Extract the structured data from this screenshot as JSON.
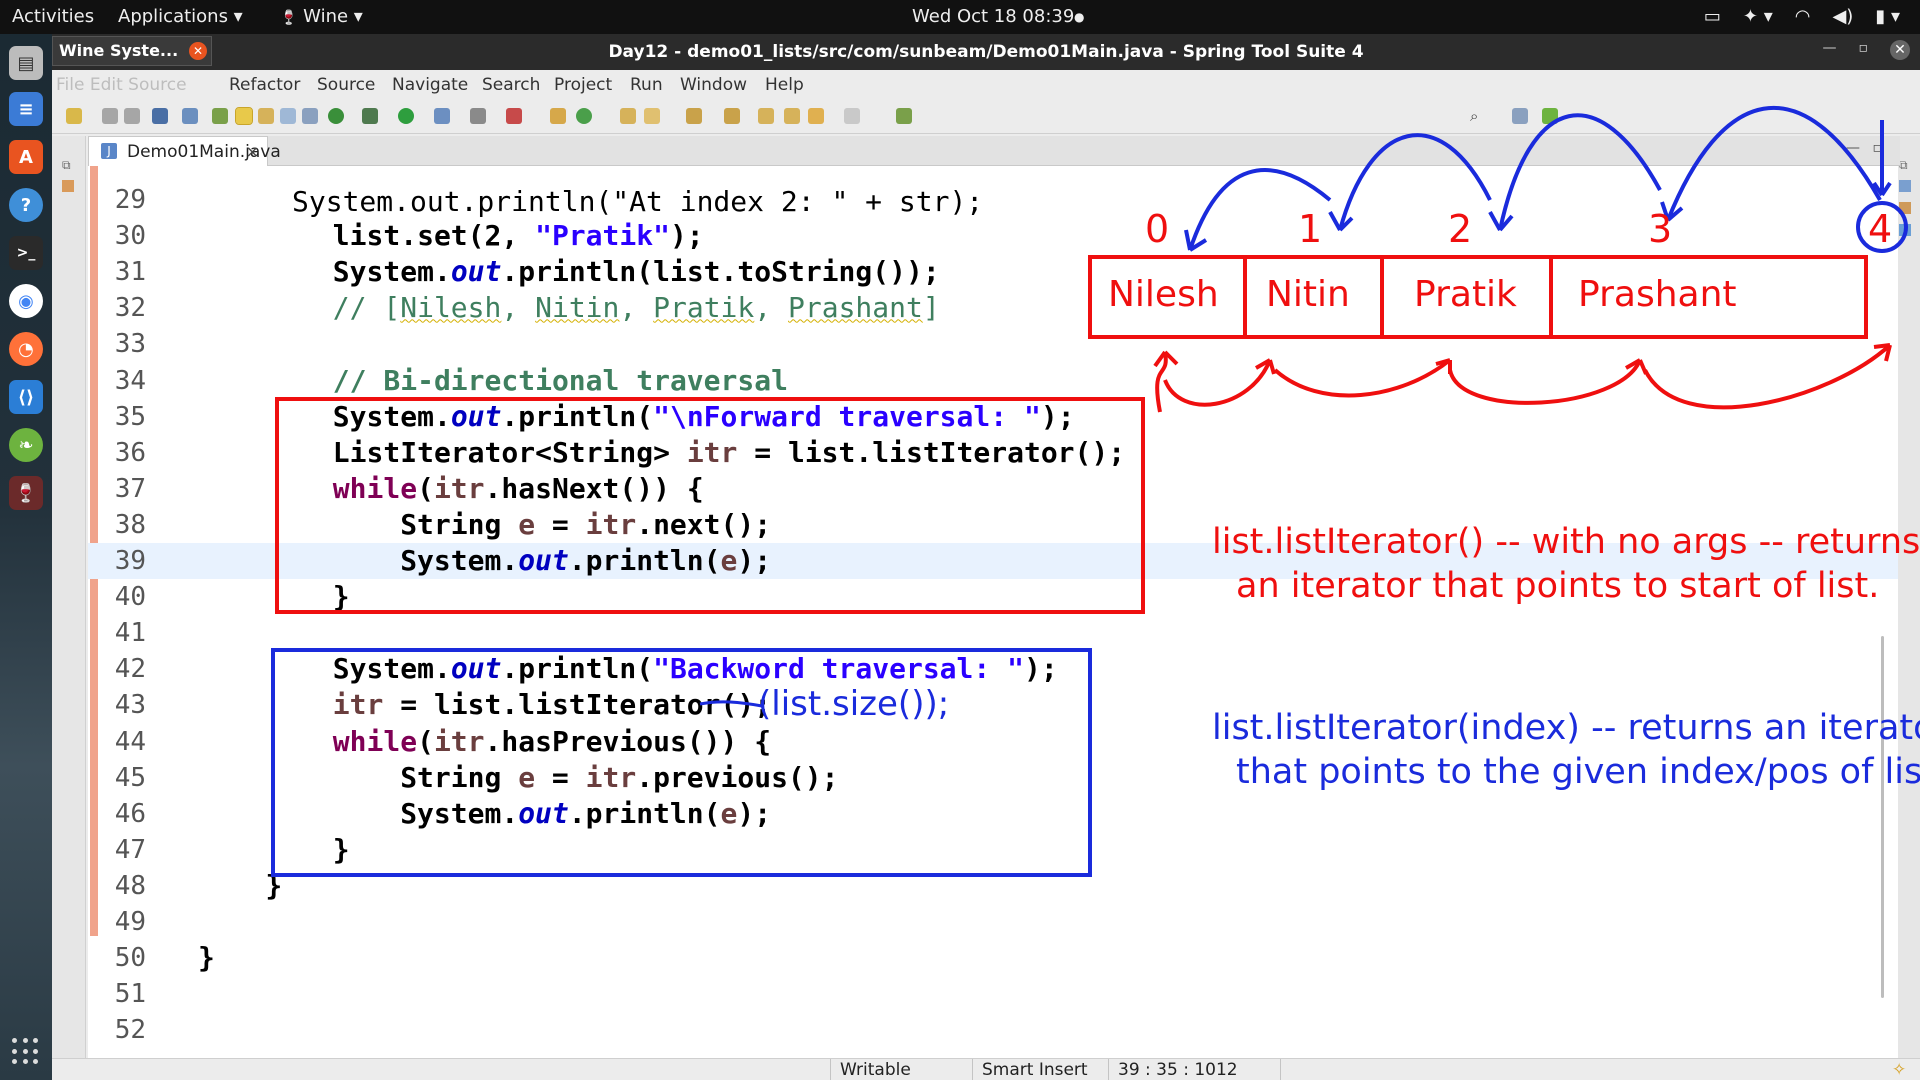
{
  "topbar": {
    "activities": "Activities",
    "applications": "Applications ▾",
    "wine": "Wine ▾",
    "clock": "Wed Oct 18  08:39",
    "tray_icons": [
      "display-icon",
      "accessibility-icon",
      "network-icon",
      "volume-icon",
      "battery-icon"
    ]
  },
  "dock": {
    "apps": [
      "files-icon",
      "text-editor-icon",
      "software-store-icon",
      "help-icon",
      "terminal-icon",
      "chrome-icon",
      "firefox-icon",
      "vscode-icon",
      "spring-icon",
      "wine-icon"
    ]
  },
  "window": {
    "title": "Day12 - demo01_lists/src/com/sunbeam/Demo01Main.java - Spring Tool Suite 4",
    "wine_popup": "Wine Syste...",
    "menu": [
      "Refactor",
      "Source",
      "Navigate",
      "Search",
      "Project",
      "Run",
      "Window",
      "Help"
    ],
    "menu_ghost": "File  Edit  Source"
  },
  "editor": {
    "tab_label": "Demo01Main.java",
    "tab_close": "×",
    "partial_top": "System.out.println(\"At index 2: \" + str);"
  },
  "code_lines": [
    {
      "n": "29",
      "text": ""
    },
    {
      "n": "30",
      "text": "list.set(2, \"Pratik\");"
    },
    {
      "n": "31",
      "text": "System.out.println(list.toString());"
    },
    {
      "n": "32",
      "text": "// [Nilesh, Nitin, Pratik, Prashant]"
    },
    {
      "n": "33",
      "text": ""
    },
    {
      "n": "34",
      "text": "// Bi-directional traversal"
    },
    {
      "n": "35",
      "text": "System.out.println(\"\\nForward traversal: \");"
    },
    {
      "n": "36",
      "text": "ListIterator<String> itr = list.listIterator();"
    },
    {
      "n": "37",
      "text": "while(itr.hasNext()) {"
    },
    {
      "n": "38",
      "text": "String e = itr.next();"
    },
    {
      "n": "39",
      "text": "System.out.println(e);"
    },
    {
      "n": "40",
      "text": "}"
    },
    {
      "n": "41",
      "text": ""
    },
    {
      "n": "42",
      "text": "System.out.println(\"Backword traversal: \");"
    },
    {
      "n": "43",
      "text": "itr = list.listIterator();"
    },
    {
      "n": "44",
      "text": "while(itr.hasPrevious()) {"
    },
    {
      "n": "45",
      "text": "String e = itr.previous();"
    },
    {
      "n": "46",
      "text": "System.out.println(e);"
    },
    {
      "n": "47",
      "text": "}"
    },
    {
      "n": "48",
      "text": "}"
    },
    {
      "n": "49",
      "text": ""
    },
    {
      "n": "50",
      "text": "}"
    },
    {
      "n": "51",
      "text": ""
    },
    {
      "n": "52",
      "text": ""
    }
  ],
  "status": {
    "writable": "Writable",
    "insert_mode": "Smart Insert",
    "position": "39 : 35 : 1012"
  },
  "annotations": {
    "indices": [
      "0",
      "1",
      "2",
      "3",
      "4"
    ],
    "names": [
      "Nilesh",
      "Nitin",
      "Pratik",
      "Prashant"
    ],
    "handwritten_arg": "(list.size());",
    "note_no_args_line1": "list.listIterator() -- with no args -- returns",
    "note_no_args_line2": "an iterator that points to start of list.",
    "note_index_line1": "list.listIterator(index) -- returns an iterator",
    "note_index_line2": "that points to the given index/pos of list.",
    "red": "#ef0f0f",
    "blue": "#1a2bdc"
  }
}
